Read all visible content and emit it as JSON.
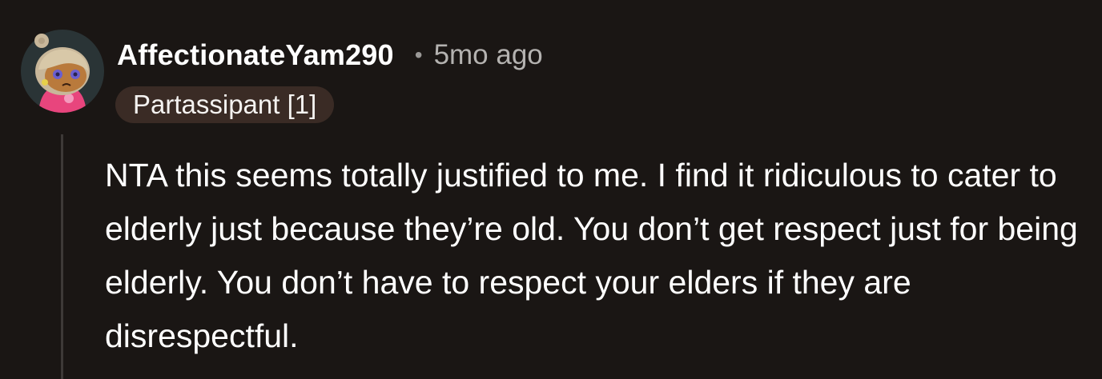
{
  "comment": {
    "avatar_icon": "snoo-avatar-icon",
    "username": "AffectionateYam290",
    "separator": "•",
    "timestamp": "5mo ago",
    "flair": "Partassipant [1]",
    "body": "NTA this seems totally justified to me. I find it ridiculous to cater to elderly just because they’re old. You don’t get respect just for being elderly. You don’t have to respect your elders if they are disrespectful."
  },
  "colors": {
    "background": "#1a1614",
    "flair_background": "#3a2b25",
    "text": "#ffffff",
    "muted_text": "#b4b2b0",
    "thread_line": "#3d3937"
  }
}
